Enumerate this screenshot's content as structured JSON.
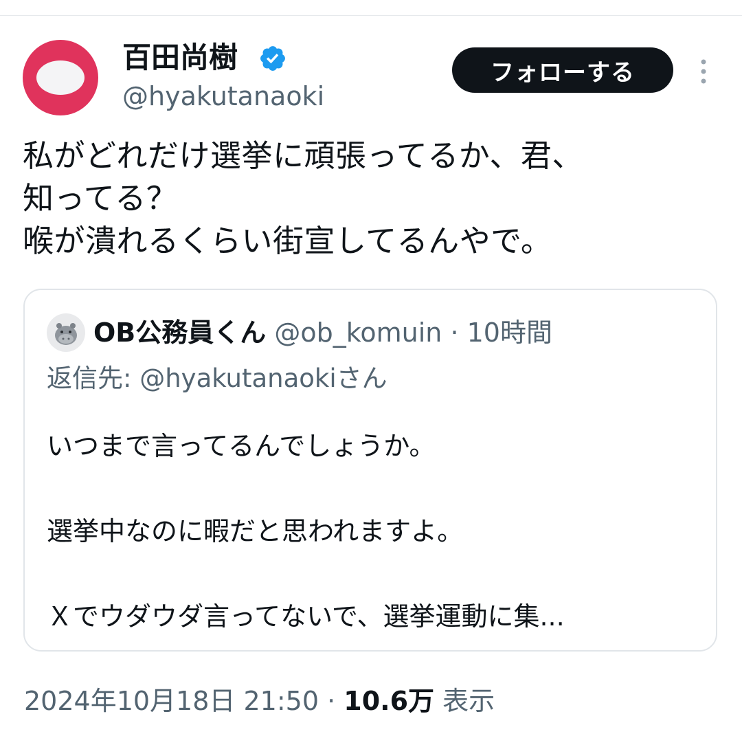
{
  "author": {
    "display_name": "百田尚樹",
    "handle": "@hyakutanaoki",
    "verified": true,
    "avatar_icon": "red-circle-avatar-icon"
  },
  "follow_button": {
    "label": "フォローする"
  },
  "more_icon": "more-vertical-icon",
  "tweet": {
    "lines": [
      "私がどれだけ選挙に頑張ってるか、君、",
      "知ってる？",
      "喉が潰れるくらい街宣してるんやで。"
    ]
  },
  "quote": {
    "avatar_icon": "hippo-avatar-icon",
    "name": "OB公務員くん",
    "meta": " @ob_komuin · 10時間",
    "reply_to": "返信先: @hyakutanaokiさん",
    "lines": [
      "いつまで言ってるんでしょうか。",
      "",
      "選挙中なのに暇だと思われますよ。",
      "",
      "Ｘでウダウダ言ってないで、選挙運動に集..."
    ]
  },
  "footer": {
    "datetime": "2024年10月18日 21:50 · ",
    "views_count": "10.6万",
    "views_label": " 表示"
  },
  "colors": {
    "text": "#0f1419",
    "secondary": "#536471",
    "verified": "#1d9bf0",
    "avatar_bg": "#e0335c",
    "button_bg": "#0f1419"
  }
}
